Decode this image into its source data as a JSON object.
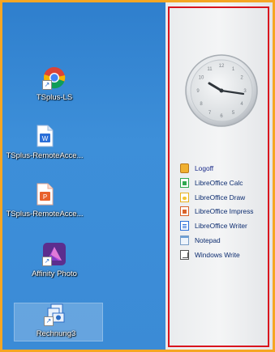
{
  "desktop": {
    "icons": [
      {
        "label": "TSplus-LS",
        "icon": "chrome-icon"
      },
      {
        "label": "TSplus-RemoteAcce...",
        "icon": "word-document-icon"
      },
      {
        "label": "TSplus-RemoteAcce...",
        "icon": "presentation-document-icon"
      },
      {
        "label": "Affinity Photo",
        "icon": "affinity-photo-icon"
      },
      {
        "label": "Rechnung3",
        "icon": "network-share-icon"
      }
    ]
  },
  "panel": {
    "clock": {
      "hour_hand": 10,
      "minute_hand": 15
    },
    "menu": [
      {
        "label": "Logoff",
        "icon": "logoff-key-icon"
      },
      {
        "label": "LibreOffice Calc",
        "icon": "calc-icon"
      },
      {
        "label": "LibreOffice Draw",
        "icon": "draw-icon"
      },
      {
        "label": "LibreOffice Impress",
        "icon": "impress-icon"
      },
      {
        "label": "LibreOffice Writer",
        "icon": "writer-icon"
      },
      {
        "label": "Notepad",
        "icon": "notepad-icon"
      },
      {
        "label": "Windows Write",
        "icon": "windows-write-icon"
      }
    ]
  },
  "colors": {
    "border_orange": "#f5a623",
    "desktop_blue": "#3b8bd6",
    "highlight_red": "#d9141e",
    "menu_text": "#0b2b6f"
  }
}
